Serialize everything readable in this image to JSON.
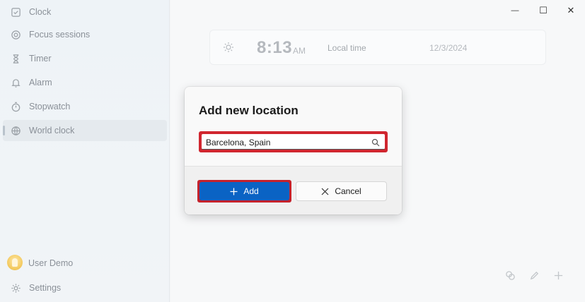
{
  "sidebar": {
    "items": [
      {
        "label": "Clock",
        "icon": "clock-check-icon"
      },
      {
        "label": "Focus sessions",
        "icon": "focus-icon"
      },
      {
        "label": "Timer",
        "icon": "hourglass-icon"
      },
      {
        "label": "Alarm",
        "icon": "bell-icon"
      },
      {
        "label": "Stopwatch",
        "icon": "stopwatch-icon"
      },
      {
        "label": "World clock",
        "icon": "globe-icon",
        "selected": true
      }
    ],
    "user": {
      "label": "User Demo",
      "icon": "avatar"
    },
    "settings": {
      "label": "Settings",
      "icon": "gear-icon"
    }
  },
  "titlebar": {
    "minimize": "—",
    "maximize": "☐",
    "close": "✕"
  },
  "clock_card": {
    "time": "8:13",
    "ampm": "AM",
    "label": "Local time",
    "date": "12/3/2024"
  },
  "dialog": {
    "title": "Add new location",
    "search_value": "Barcelona, Spain",
    "add_label": "Add",
    "cancel_label": "Cancel",
    "highlight_color": "#d0262f",
    "accent_color": "#0a63c4"
  },
  "bottom_toolbar": {
    "icons": [
      "compare-icon",
      "edit-icon",
      "add-icon"
    ]
  }
}
